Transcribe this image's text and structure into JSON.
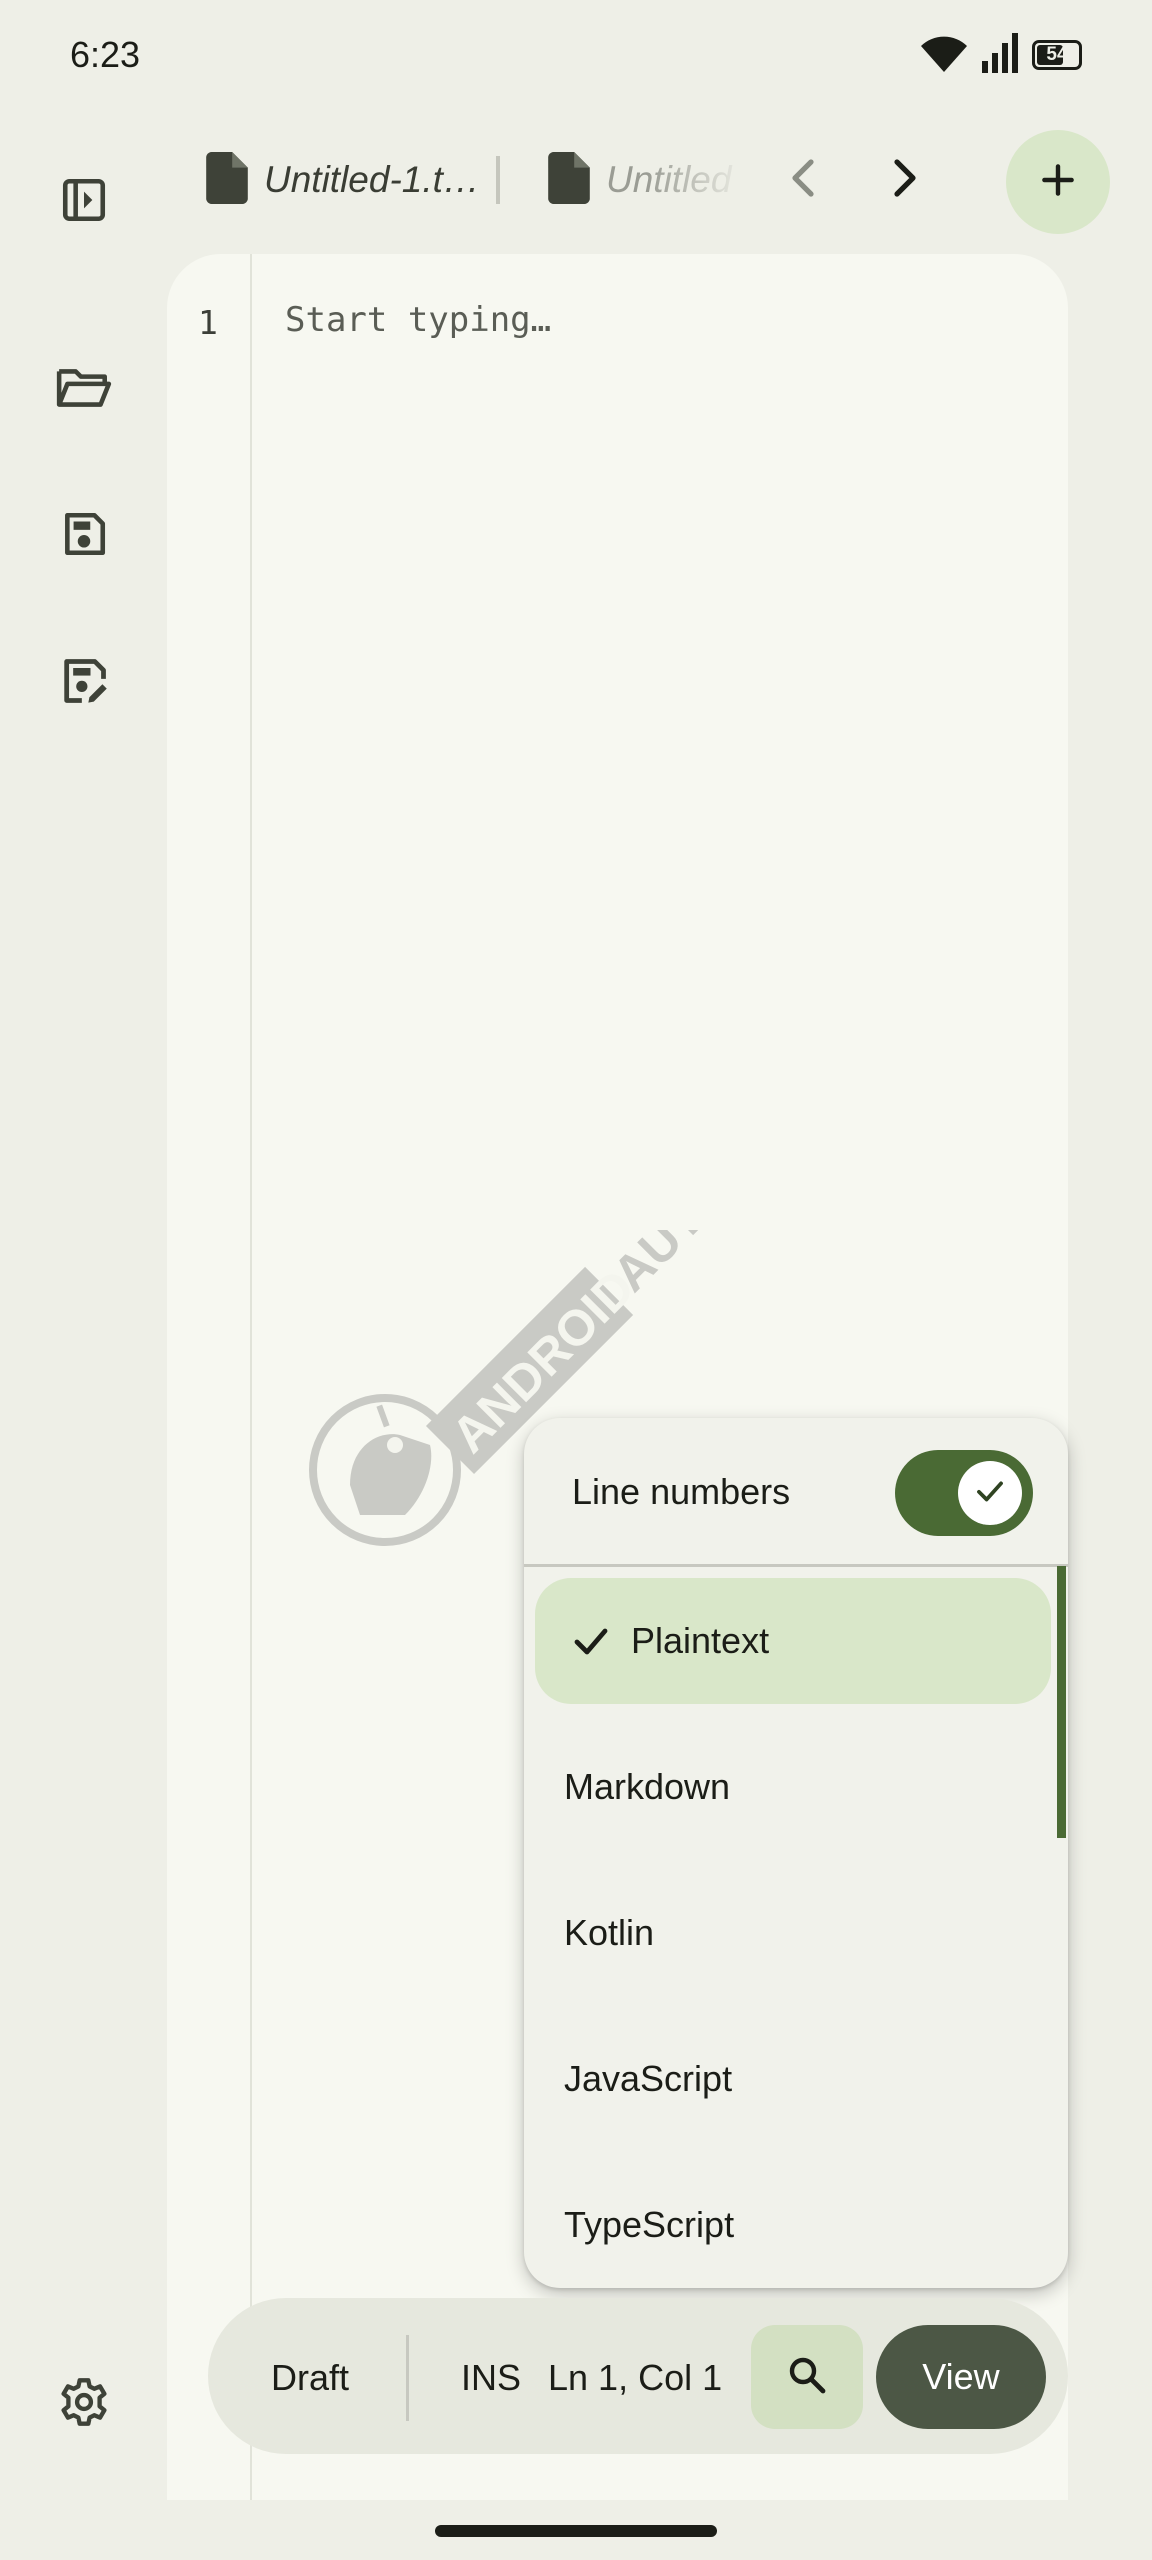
{
  "status_bar": {
    "time": "6:23",
    "battery_level": "54",
    "icons": [
      "wifi-icon",
      "cellular-signal-icon",
      "battery-icon"
    ]
  },
  "nav_rail": {
    "items": [
      {
        "icon": "sidebar-toggle-icon"
      },
      {
        "icon": "open-folder-icon"
      },
      {
        "icon": "save-icon"
      },
      {
        "icon": "save-as-icon"
      }
    ],
    "settings_icon": "settings-gear-icon"
  },
  "tabs": {
    "items": [
      {
        "label": "Untitled-1.t…",
        "icon": "file-icon",
        "active": true
      },
      {
        "label": "Untitled",
        "icon": "file-icon",
        "active": false
      }
    ],
    "prev_icon": "chevron-left-icon",
    "next_icon": "chevron-right-icon",
    "add_icon": "plus-icon"
  },
  "editor": {
    "line_number": "1",
    "placeholder": "Start typing…"
  },
  "watermark": {
    "text": "ANDROID AUTHORITY"
  },
  "menu": {
    "toggle_label": "Line numbers",
    "toggle_on": true,
    "items": [
      {
        "label": "Plaintext",
        "selected": true
      },
      {
        "label": "Markdown",
        "selected": false
      },
      {
        "label": "Kotlin",
        "selected": false
      },
      {
        "label": "JavaScript",
        "selected": false
      },
      {
        "label": "TypeScript",
        "selected": false
      }
    ]
  },
  "status_pill": {
    "mode": "Draft",
    "insert_mode": "INS",
    "cursor_position": "Ln 1, Col 1",
    "search_icon": "search-icon",
    "view_label": "View"
  },
  "colors": {
    "background": "#eeefe7",
    "editor_surface": "#f7f8f1",
    "accent": "#4a6a34",
    "accent_container": "#d9e7c9",
    "view_button": "#4c5745"
  }
}
